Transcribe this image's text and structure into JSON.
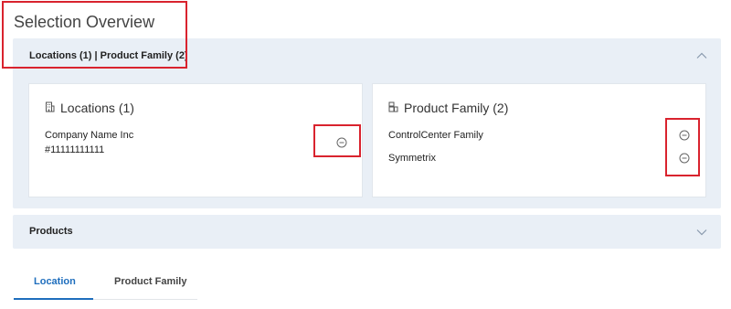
{
  "page": {
    "title": "Selection Overview"
  },
  "selection_panel": {
    "header": "Locations (1) | Product Family (2)",
    "expanded": true
  },
  "locations_card": {
    "title": "Locations (1)",
    "icon": "building-icon",
    "company_name": "Company Name Inc",
    "company_id": "#11111111111"
  },
  "product_family_card": {
    "title": "Product Family (2)",
    "icon": "product-family-icon",
    "items": [
      {
        "label": "ControlCenter Family"
      },
      {
        "label": "Symmetrix"
      }
    ]
  },
  "products_panel": {
    "header": "Products",
    "expanded": false
  },
  "tabs": [
    {
      "label": "Location",
      "active": true
    },
    {
      "label": "Product Family",
      "active": false
    }
  ],
  "colors": {
    "accent": "#1f6ebd",
    "panel_bg": "#e9eff6",
    "annotation": "#d9232e"
  }
}
